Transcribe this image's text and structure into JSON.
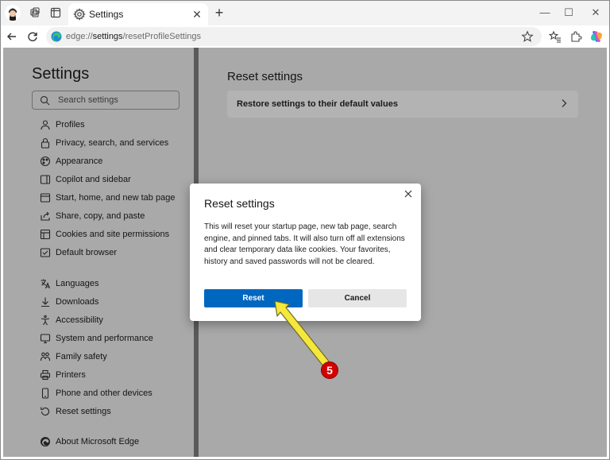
{
  "browser": {
    "tab_title": "Settings",
    "tab_close": "✕",
    "new_tab": "+",
    "window_controls": [
      "—",
      "☐",
      "✕"
    ],
    "url_prefix": "edge://",
    "url_bold": "settings",
    "url_suffix": "/resetProfileSettings"
  },
  "sidebar": {
    "title": "Settings",
    "search_placeholder": "Search settings",
    "items": [
      {
        "label": "Profiles",
        "icon": "profile-icon"
      },
      {
        "label": "Privacy, search, and services",
        "icon": "lock-icon"
      },
      {
        "label": "Appearance",
        "icon": "appearance-icon"
      },
      {
        "label": "Copilot and sidebar",
        "icon": "sidebar-icon"
      },
      {
        "label": "Start, home, and new tab page",
        "icon": "home-icon"
      },
      {
        "label": "Share, copy, and paste",
        "icon": "share-icon"
      },
      {
        "label": "Cookies and site permissions",
        "icon": "cookies-icon"
      },
      {
        "label": "Default browser",
        "icon": "browser-icon"
      },
      {
        "label": "Languages",
        "icon": "languages-icon"
      },
      {
        "label": "Downloads",
        "icon": "download-icon"
      },
      {
        "label": "Accessibility",
        "icon": "accessibility-icon"
      },
      {
        "label": "System and performance",
        "icon": "system-icon"
      },
      {
        "label": "Family safety",
        "icon": "family-icon"
      },
      {
        "label": "Printers",
        "icon": "printer-icon"
      },
      {
        "label": "Phone and other devices",
        "icon": "phone-icon"
      },
      {
        "label": "Reset settings",
        "icon": "reset-icon"
      },
      {
        "label": "About Microsoft Edge",
        "icon": "edge-icon"
      }
    ]
  },
  "main": {
    "title": "Reset settings",
    "card_label": "Restore settings to their default values"
  },
  "dialog": {
    "title": "Reset settings",
    "body": "This will reset your startup page, new tab page, search engine, and pinned tabs. It will also turn off all extensions and clear temporary data like cookies. Your favorites, history and saved passwords will not be cleared.",
    "reset_label": "Reset",
    "cancel_label": "Cancel"
  },
  "annotation": {
    "step": "5"
  },
  "colors": {
    "accent": "#0067c0",
    "overlay": "#a9a9a9",
    "badge": "#d40000",
    "arrow": "#f5e83a"
  }
}
